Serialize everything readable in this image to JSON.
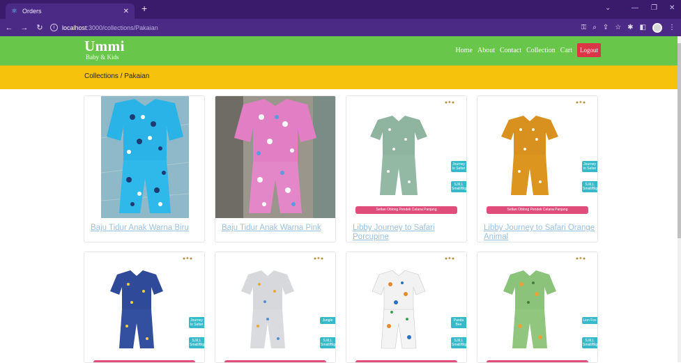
{
  "browser": {
    "tab_title": "Orders",
    "url_host": "localhost",
    "url_path": ":3000/collections/Pakaian"
  },
  "site": {
    "brand_name": "Ummi",
    "brand_sub": "Baby & Kids",
    "menu": [
      "Home",
      "About",
      "Contact",
      "Collection",
      "Cart"
    ],
    "logout_label": "Logout",
    "breadcrumb": "Collections / Pakaian",
    "colors": {
      "nav": "#68c64a",
      "breadcrumb": "#f6c20c",
      "logout": "#dc3545",
      "tab": "#4b2a86"
    }
  },
  "products": [
    {
      "title": "Baju Tidur Anak Warna Biru",
      "image": "blue-pajama-photo"
    },
    {
      "title": "Baju Tidur Anak Warna Pink",
      "image": "pink-pajama-photo"
    },
    {
      "title": "Libby Journey to Safari Porcupine",
      "image": "mint-pajama-catalog",
      "side_top": "Journey to Safari",
      "side_bottom": "S,M,L Small/Big",
      "ribbon": "Setlan Oblong Pendek Celana Panjang"
    },
    {
      "title": "Libby Journey to Safari Orange Animal",
      "image": "orange-pajama-catalog",
      "side_top": "Journey to Safari",
      "side_bottom": "S,M,L Small/Big",
      "ribbon": "Setlan Oblong Pendek Celana Panjang"
    },
    {
      "image": "navy-pajama-catalog",
      "side_top": "Journey to Safari",
      "side_bottom": "S,M,L Small/Big"
    },
    {
      "image": "grey-pajama-catalog",
      "side_top": "Jungle",
      "side_bottom": "S,M,L Small/Big"
    },
    {
      "image": "white-pajama-catalog",
      "side_top": "Panda Bee",
      "side_bottom": "S,M,L Small/Big"
    },
    {
      "image": "green-pajama-catalog",
      "side_top": "Lion Fox",
      "side_bottom": "S,M,L Small/Big"
    }
  ]
}
